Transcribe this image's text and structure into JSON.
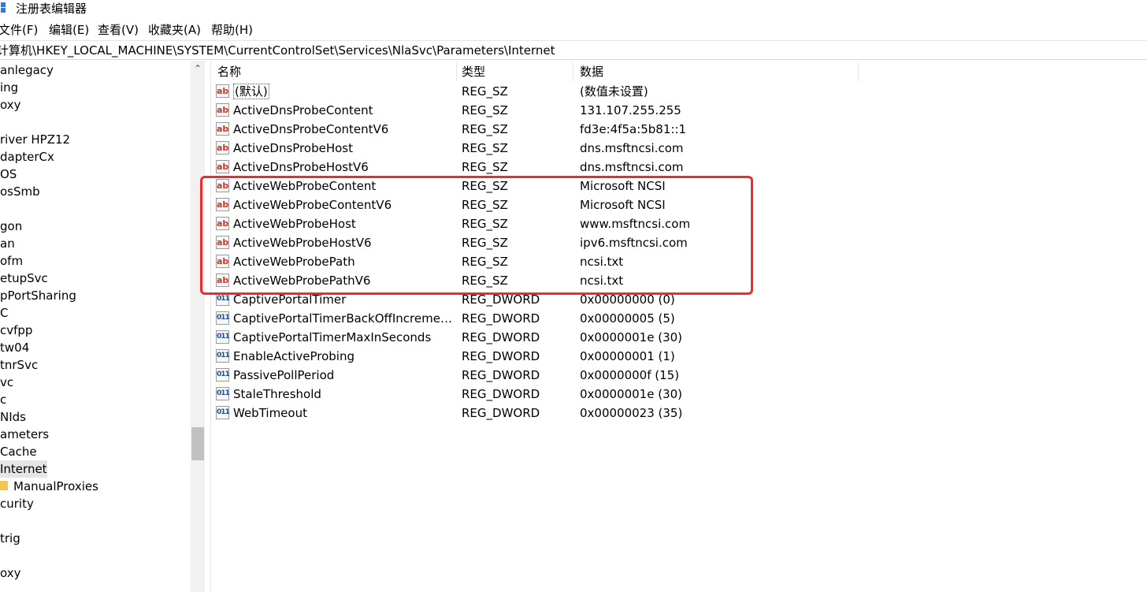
{
  "window": {
    "title": "注册表编辑器"
  },
  "menu": [
    {
      "label": "文件(F)"
    },
    {
      "label": "编辑(E)"
    },
    {
      "label": "查看(V)"
    },
    {
      "label": "收藏夹(A)"
    },
    {
      "label": "帮助(H)"
    }
  ],
  "address": {
    "path": "计算机\\HKEY_LOCAL_MACHINE\\SYSTEM\\CurrentControlSet\\Services\\NlaSvc\\Parameters\\Internet"
  },
  "tree": {
    "items": [
      {
        "label": "anlegacy"
      },
      {
        "label": "ing"
      },
      {
        "label": "oxy"
      },
      {
        "label": ""
      },
      {
        "label": "river HPZ12"
      },
      {
        "label": "dapterCx"
      },
      {
        "label": "OS"
      },
      {
        "label": "osSmb"
      },
      {
        "label": ""
      },
      {
        "label": "gon"
      },
      {
        "label": "an"
      },
      {
        "label": "ofm"
      },
      {
        "label": "etupSvc"
      },
      {
        "label": "pPortSharing"
      },
      {
        "label": "C"
      },
      {
        "label": "cvfpp"
      },
      {
        "label": "tw04"
      },
      {
        "label": "tnrSvc"
      },
      {
        "label": "vc"
      },
      {
        "label": "c"
      },
      {
        "label": "NIds"
      },
      {
        "label": "ameters"
      },
      {
        "label": "Cache"
      },
      {
        "label": "Internet"
      },
      {
        "label": "ManualProxies"
      },
      {
        "label": "curity"
      },
      {
        "label": ""
      },
      {
        "label": "trig"
      },
      {
        "label": ""
      },
      {
        "label": "oxy"
      }
    ]
  },
  "list": {
    "columns": {
      "name": "名称",
      "type": "类型",
      "data": "数据"
    },
    "rows": [
      {
        "name": "(默认)",
        "type": "REG_SZ",
        "data": "(数值未设置)",
        "icon": "string-value-icon"
      },
      {
        "name": "ActiveDnsProbeContent",
        "type": "REG_SZ",
        "data": "131.107.255.255",
        "icon": "string-value-icon"
      },
      {
        "name": "ActiveDnsProbeContentV6",
        "type": "REG_SZ",
        "data": "fd3e:4f5a:5b81::1",
        "icon": "string-value-icon"
      },
      {
        "name": "ActiveDnsProbeHost",
        "type": "REG_SZ",
        "data": "dns.msftncsi.com",
        "icon": "string-value-icon"
      },
      {
        "name": "ActiveDnsProbeHostV6",
        "type": "REG_SZ",
        "data": "dns.msftncsi.com",
        "icon": "string-value-icon"
      },
      {
        "name": "ActiveWebProbeContent",
        "type": "REG_SZ",
        "data": "Microsoft NCSI",
        "icon": "string-value-icon"
      },
      {
        "name": "ActiveWebProbeContentV6",
        "type": "REG_SZ",
        "data": "Microsoft NCSI",
        "icon": "string-value-icon"
      },
      {
        "name": "ActiveWebProbeHost",
        "type": "REG_SZ",
        "data": "www.msftncsi.com",
        "icon": "string-value-icon"
      },
      {
        "name": "ActiveWebProbeHostV6",
        "type": "REG_SZ",
        "data": "ipv6.msftncsi.com",
        "icon": "string-value-icon"
      },
      {
        "name": "ActiveWebProbePath",
        "type": "REG_SZ",
        "data": "ncsi.txt",
        "icon": "string-value-icon"
      },
      {
        "name": "ActiveWebProbePathV6",
        "type": "REG_SZ",
        "data": "ncsi.txt",
        "icon": "string-value-icon"
      },
      {
        "name": "CaptivePortalTimer",
        "type": "REG_DWORD",
        "data": "0x00000000 (0)",
        "icon": "dword-value-icon"
      },
      {
        "name": "CaptivePortalTimerBackOffIncrement...",
        "type": "REG_DWORD",
        "data": "0x00000005 (5)",
        "icon": "dword-value-icon"
      },
      {
        "name": "CaptivePortalTimerMaxInSeconds",
        "type": "REG_DWORD",
        "data": "0x0000001e (30)",
        "icon": "dword-value-icon"
      },
      {
        "name": "EnableActiveProbing",
        "type": "REG_DWORD",
        "data": "0x00000001 (1)",
        "icon": "dword-value-icon"
      },
      {
        "name": "PassivePollPeriod",
        "type": "REG_DWORD",
        "data": "0x0000000f (15)",
        "icon": "dword-value-icon"
      },
      {
        "name": "StaleThreshold",
        "type": "REG_DWORD",
        "data": "0x0000001e (30)",
        "icon": "dword-value-icon"
      },
      {
        "name": "WebTimeout",
        "type": "REG_DWORD",
        "data": "0x00000023 (35)",
        "icon": "dword-value-icon"
      }
    ]
  },
  "icons": {
    "string_glyph": "ab",
    "dword_glyph": "011",
    "scroll_up_glyph": "⌃"
  },
  "colors": {
    "highlight_box": "#ee2a2a",
    "selection": "#e5e5e5",
    "folder": "#f3c64f"
  }
}
